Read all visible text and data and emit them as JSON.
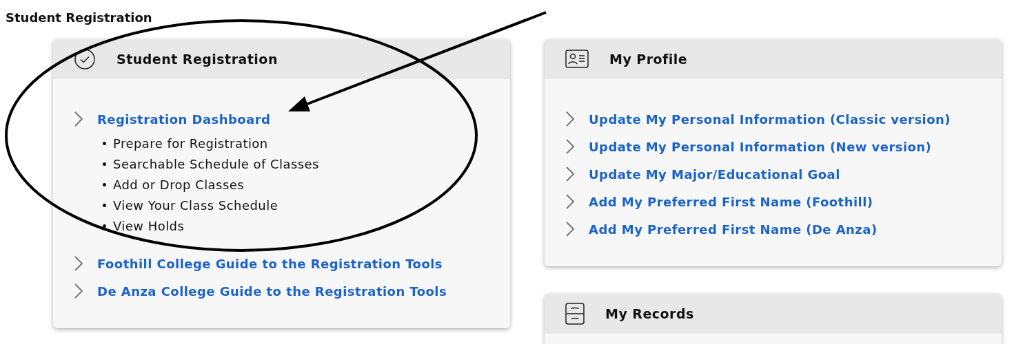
{
  "page_title": "Student Registration",
  "columns": [
    {
      "cards": [
        {
          "kind": "registration",
          "title": "Student Registration",
          "links": [
            {
              "label": "Registration Dashboard",
              "subitems": [
                "Prepare for Registration",
                "Searchable Schedule of Classes",
                "Add or Drop Classes",
                "View Your Class Schedule",
                "View Holds"
              ]
            },
            {
              "label": "Foothill College Guide to the Registration Tools"
            },
            {
              "label": "De Anza College Guide to the Registration Tools"
            }
          ]
        }
      ]
    },
    {
      "cards": [
        {
          "kind": "profile",
          "title": "My Profile",
          "links": [
            {
              "label": "Update My Personal Information (Classic version)"
            },
            {
              "label": "Update My Personal Information (New version)"
            },
            {
              "label": "Update My Major/Educational Goal"
            },
            {
              "label": "Add My Preferred First Name (Foothill)"
            },
            {
              "label": "Add My Preferred First Name (De Anza)"
            }
          ]
        },
        {
          "kind": "records",
          "title": "My Records"
        }
      ]
    }
  ]
}
